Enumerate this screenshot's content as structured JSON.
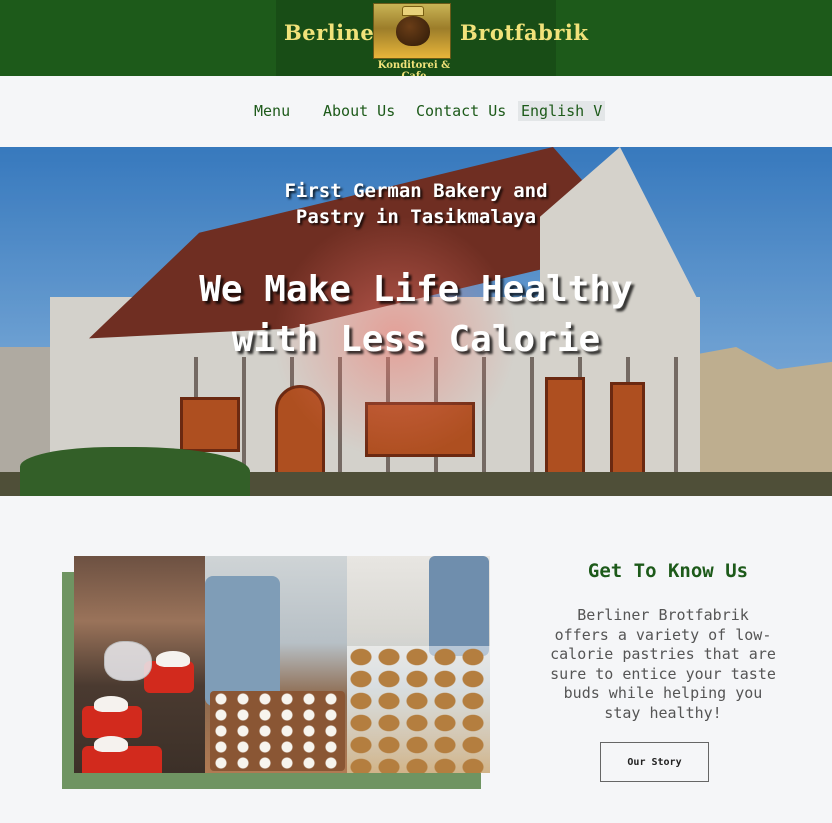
{
  "brand": {
    "name_left": "Berliner",
    "name_right": "Brotfabrik",
    "tagline": "Konditorei & Cafe",
    "header_color": "#1d5a1a",
    "logo_text_color": "#f1e27a"
  },
  "nav": {
    "items": [
      {
        "label": "Menu"
      },
      {
        "label": "About Us"
      },
      {
        "label": "Contact Us"
      }
    ],
    "language": "English V"
  },
  "hero": {
    "subtitle": "First German Bakery and Pastry in Tasikmalaya",
    "title": "We Make Life Healthy with Less Calorie"
  },
  "about": {
    "heading": "Get To Know Us",
    "body": "Berliner Brotfabrik offers a variety of low-calorie pastries that are sure to entice your taste buds while helping you stay healthy!",
    "button_label": "Our Story",
    "accent_color": "#6f9462"
  }
}
